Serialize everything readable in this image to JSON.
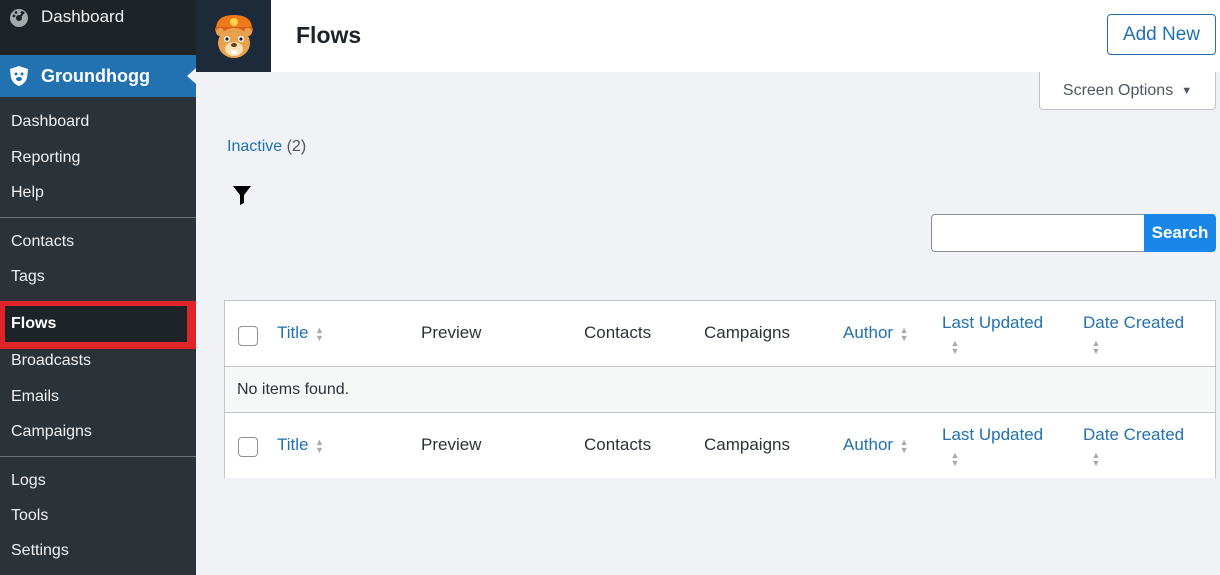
{
  "sidebar": {
    "dashboard_label": "Dashboard",
    "groundhogg_label": "Groundhogg",
    "submenu": {
      "dashboard": "Dashboard",
      "reporting": "Reporting",
      "help": "Help",
      "contacts": "Contacts",
      "tags": "Tags",
      "flows": "Flows",
      "broadcasts": "Broadcasts",
      "emails": "Emails",
      "campaigns": "Campaigns",
      "logs": "Logs",
      "tools": "Tools",
      "settings": "Settings"
    }
  },
  "header": {
    "title": "Flows",
    "add_new_label": "Add New"
  },
  "screen_options_label": "Screen Options",
  "views": {
    "inactive_label": "Inactive",
    "inactive_count": "(2)"
  },
  "search": {
    "button_label": "Search",
    "value": ""
  },
  "table": {
    "columns": {
      "title": "Title",
      "preview": "Preview",
      "contacts": "Contacts",
      "campaigns": "Campaigns",
      "author": "Author",
      "last_updated": "Last Updated",
      "date_created": "Date Created"
    },
    "empty_message": "No items found."
  },
  "colors": {
    "sidebar_bg": "#1d2327",
    "submenu_bg": "#2c3338",
    "accent": "#2271b1",
    "highlight_box": "#e0242a",
    "search_button": "#1a87e8"
  }
}
